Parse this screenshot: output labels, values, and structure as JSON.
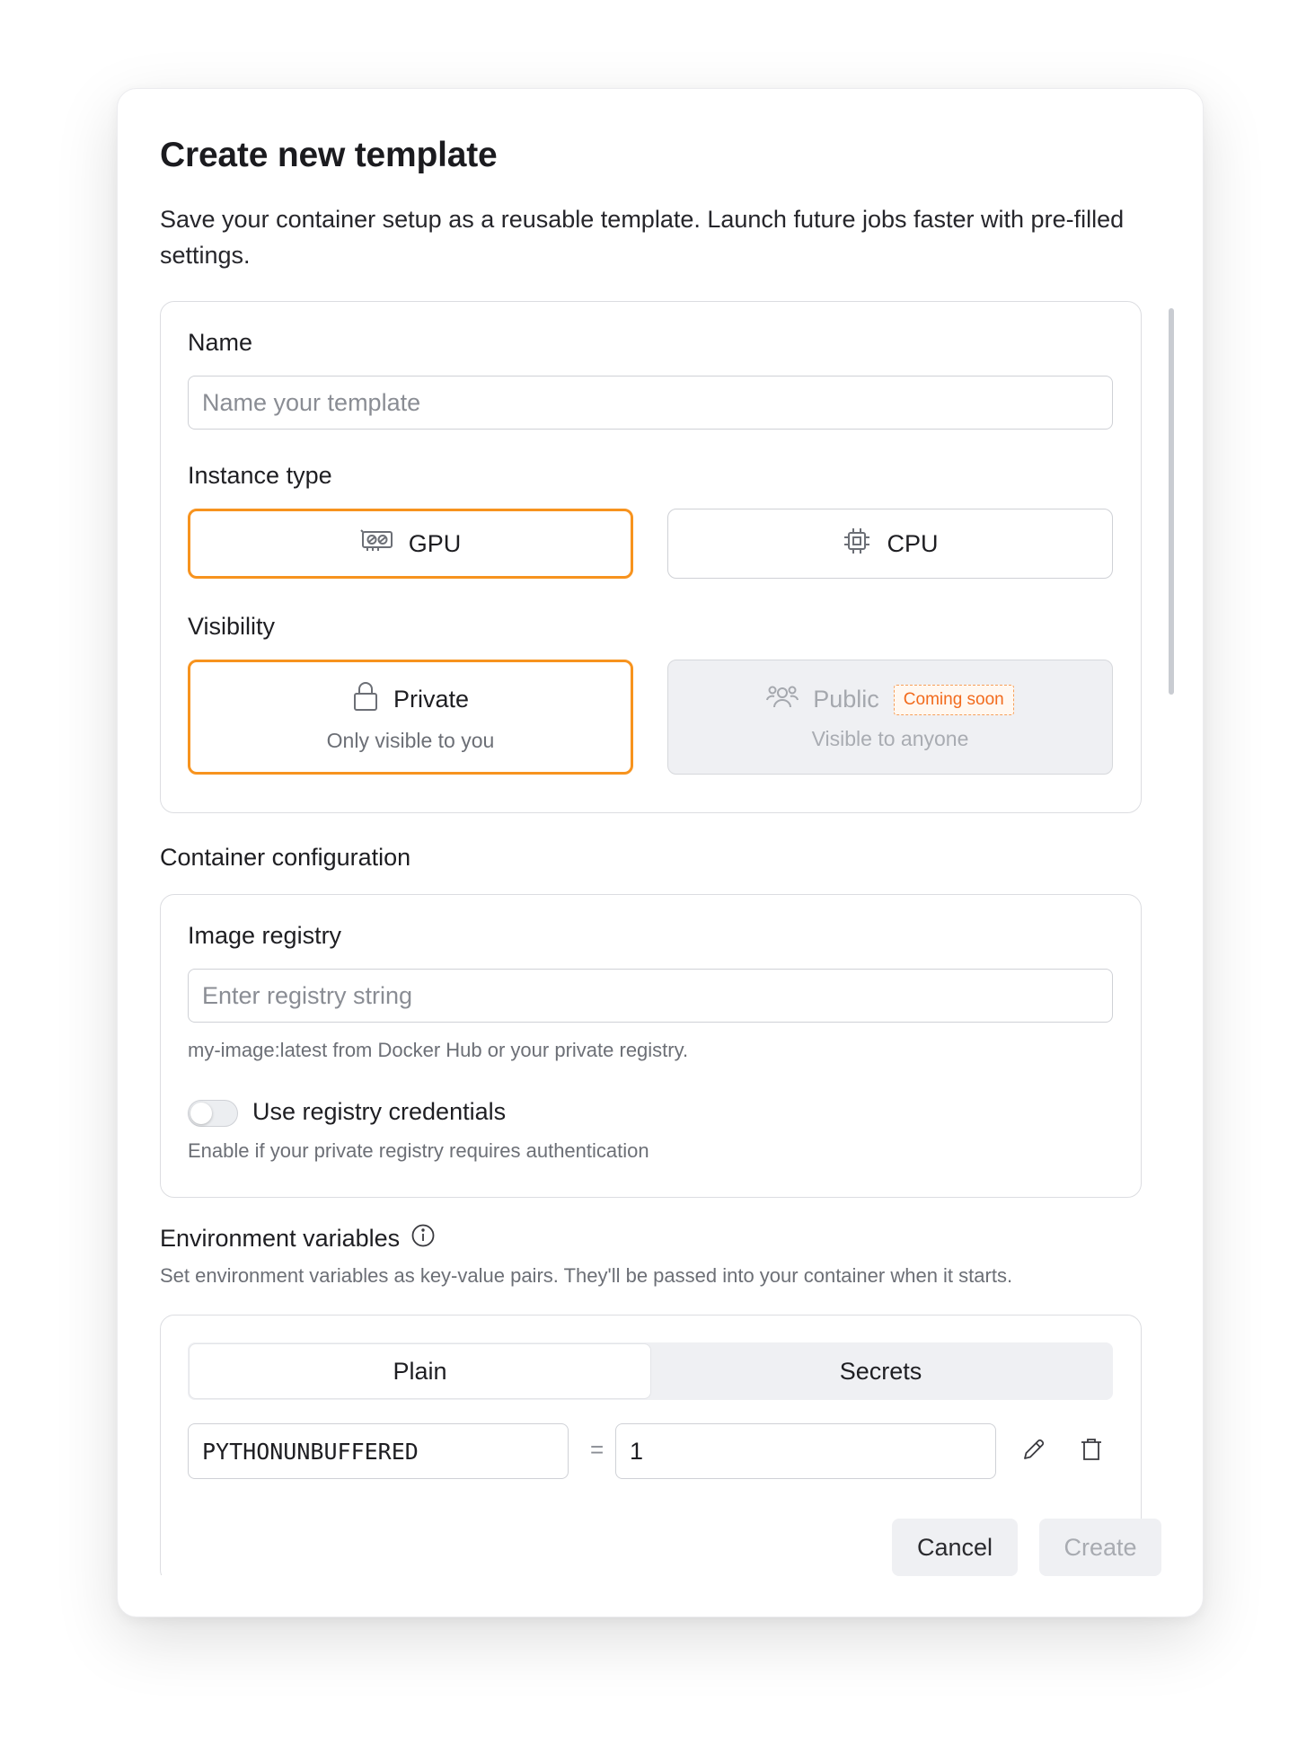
{
  "dialog": {
    "title": "Create new template",
    "subtitle": "Save your container setup as a reusable template. Launch future jobs faster with pre-filled settings."
  },
  "general": {
    "name_label": "Name",
    "name_placeholder": "Name your template",
    "instance_type_label": "Instance type",
    "instance_types": [
      {
        "label": "GPU",
        "icon": "gpu-icon",
        "selected": true
      },
      {
        "label": "CPU",
        "icon": "cpu-icon",
        "selected": false
      }
    ],
    "visibility_label": "Visibility",
    "visibility_options": [
      {
        "label": "Private",
        "description": "Only visible to you",
        "icon": "lock-icon",
        "selected": true,
        "disabled": false
      },
      {
        "label": "Public",
        "description": "Visible to anyone",
        "icon": "users-icon",
        "badge": "Coming soon",
        "selected": false,
        "disabled": true
      }
    ]
  },
  "container": {
    "section_label": "Container configuration",
    "image_registry_label": "Image registry",
    "image_registry_placeholder": "Enter registry string",
    "image_registry_hint": "my-image:latest from Docker Hub or your private registry.",
    "credentials_toggle_label": "Use registry credentials",
    "credentials_toggle_on": false,
    "credentials_hint": "Enable if your private registry requires authentication"
  },
  "env": {
    "section_label": "Environment variables",
    "info_icon": "info-icon",
    "description": "Set environment variables as key-value pairs. They'll be passed into your container when it starts.",
    "tabs": [
      {
        "label": "Plain",
        "active": true
      },
      {
        "label": "Secrets",
        "active": false
      }
    ],
    "variables": [
      {
        "key": "PYTHONUNBUFFERED",
        "separator": "=",
        "value": "1"
      }
    ]
  },
  "footer": {
    "cancel_label": "Cancel",
    "create_label": "Create"
  },
  "colors": {
    "accent": "#f7931e",
    "badge": "#f26b1d",
    "muted_bg": "#eff0f3"
  }
}
